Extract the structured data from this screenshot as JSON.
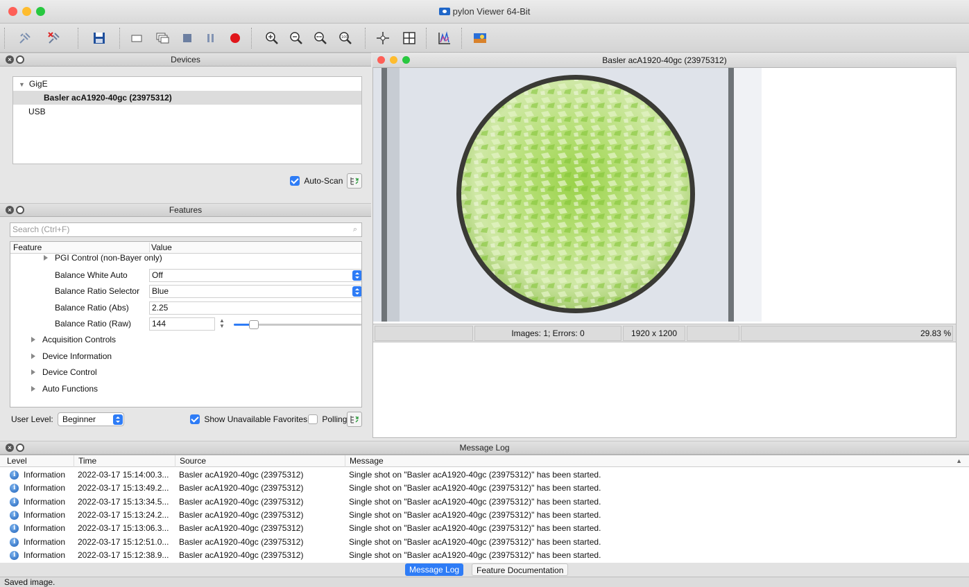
{
  "window": {
    "title": "pylon Viewer 64-Bit"
  },
  "devices": {
    "header": "Devices",
    "tree": [
      {
        "label": "GigE"
      },
      {
        "label": "Basler acA1920-40gc (23975312)"
      },
      {
        "label": "USB"
      }
    ],
    "auto_scan_label": "Auto-Scan"
  },
  "features": {
    "header": "Features",
    "search_placeholder": "Search (Ctrl+F)",
    "columns": {
      "feature": "Feature",
      "value": "Value"
    },
    "rows": [
      {
        "label": "PGI Control (non-Bayer only)"
      },
      {
        "label": "Balance White Auto",
        "value": "Off"
      },
      {
        "label": "Balance Ratio Selector",
        "value": "Blue"
      },
      {
        "label": "Balance Ratio (Abs)",
        "value": "2.25"
      },
      {
        "label": "Balance Ratio (Raw)",
        "value": "144"
      },
      {
        "label": "Acquisition Controls"
      },
      {
        "label": "Device Information"
      },
      {
        "label": "Device Control"
      },
      {
        "label": "Auto Functions"
      }
    ],
    "user_level_label": "User Level:",
    "user_level_value": "Beginner",
    "show_unavailable_label": "Show Unavailable Favorites",
    "polling_label": "Polling"
  },
  "viewer": {
    "title": "Basler acA1920-40gc (23975312)",
    "status_images": "Images: 1; Errors: 0",
    "status_resolution": "1920 x 1200",
    "status_zoom": "29.83 %"
  },
  "message_log": {
    "header": "Message Log",
    "columns": {
      "level": "Level",
      "time": "Time",
      "source": "Source",
      "message": "Message"
    },
    "rows": [
      {
        "level": "Information",
        "time": "2022-03-17 15:14:00.3...",
        "source": "Basler acA1920-40gc (23975312)",
        "message": "Single shot on \"Basler acA1920-40gc (23975312)\" has been started."
      },
      {
        "level": "Information",
        "time": "2022-03-17 15:13:49.2...",
        "source": "Basler acA1920-40gc (23975312)",
        "message": "Single shot on \"Basler acA1920-40gc (23975312)\" has been started."
      },
      {
        "level": "Information",
        "time": "2022-03-17 15:13:34.5...",
        "source": "Basler acA1920-40gc (23975312)",
        "message": "Single shot on \"Basler acA1920-40gc (23975312)\" has been started."
      },
      {
        "level": "Information",
        "time": "2022-03-17 15:13:24.2...",
        "source": "Basler acA1920-40gc (23975312)",
        "message": "Single shot on \"Basler acA1920-40gc (23975312)\" has been started."
      },
      {
        "level": "Information",
        "time": "2022-03-17 15:13:06.3...",
        "source": "Basler acA1920-40gc (23975312)",
        "message": "Single shot on \"Basler acA1920-40gc (23975312)\" has been started."
      },
      {
        "level": "Information",
        "time": "2022-03-17 15:12:51.0...",
        "source": "Basler acA1920-40gc (23975312)",
        "message": "Single shot on \"Basler acA1920-40gc (23975312)\" has been started."
      },
      {
        "level": "Information",
        "time": "2022-03-17 15:12:38.9...",
        "source": "Basler acA1920-40gc (23975312)",
        "message": "Single shot on \"Basler acA1920-40gc (23975312)\" has been started."
      }
    ],
    "tabs": [
      "Message Log",
      "Feature Documentation"
    ]
  },
  "status_bar": {
    "text": "Saved image."
  },
  "colors": {
    "accent": "#2e7cf6",
    "record": "#e0161b",
    "close_red": "#fe5f57",
    "min_yellow": "#febc2e",
    "max_green": "#28c840"
  },
  "toolbar_icons": [
    "open-device-icon",
    "close-device-icon",
    "save-icon",
    "single-shot-icon",
    "continuous-shot-icon",
    "stop-icon",
    "pause-icon",
    "record-icon",
    "zoom-in-icon",
    "zoom-out-icon",
    "zoom-fit-icon",
    "zoom-100-icon",
    "crosshair-icon",
    "grid-icon",
    "histogram-icon",
    "color-image-icon"
  ]
}
